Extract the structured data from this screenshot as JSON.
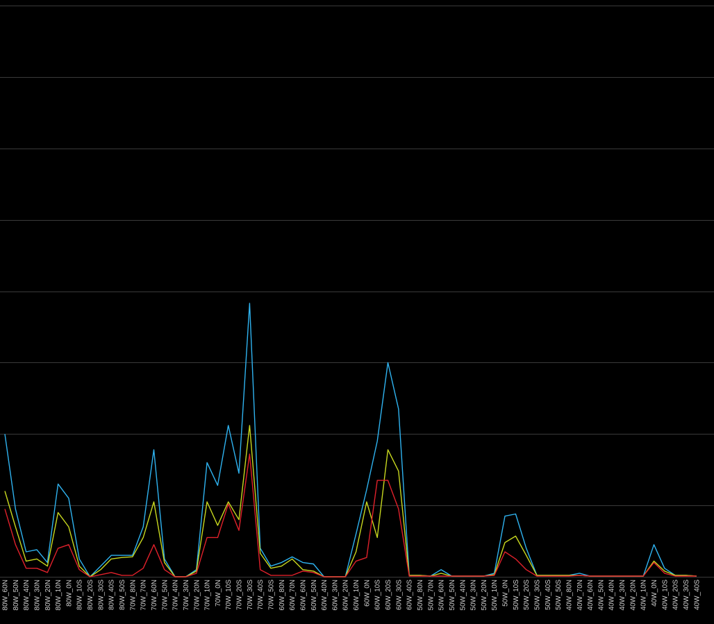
{
  "chart_data": {
    "type": "line",
    "title": "",
    "xlabel": "",
    "ylabel": "",
    "ylim": [
      0,
      8
    ],
    "grid": true,
    "legend": "none",
    "categories": [
      "80W_60N",
      "80W_50N",
      "80W_40N",
      "80W_30N",
      "80W_20N",
      "80W_10N",
      "80W_0N",
      "80W_10S",
      "80W_20S",
      "80W_30S",
      "80W_40S",
      "80W_50S",
      "70W_80N",
      "70W_70N",
      "70W_60N",
      "70W_50N",
      "70W_40N",
      "70W_30N",
      "70W_20N",
      "70W_10N",
      "70W_0N",
      "70W_10S",
      "70W_20S",
      "70W_30S",
      "70W_40S",
      "70W_50S",
      "60W_80N",
      "60W_70N",
      "60W_60N",
      "60W_50N",
      "60W_40N",
      "60W_30N",
      "60W_20N",
      "60W_10N",
      "60W_0N",
      "60W_10S",
      "60W_20S",
      "60W_30S",
      "60W_40S",
      "50W_80N",
      "50W_70N",
      "50W_60N",
      "50W_50N",
      "50W_40N",
      "50W_30N",
      "50W_20N",
      "50W_10N",
      "50W_0N",
      "50W_10S",
      "50W_20S",
      "50W_30S",
      "50W_40S",
      "50W_50S",
      "40W_80N",
      "40W_70N",
      "40W_60N",
      "40W_50N",
      "40W_40N",
      "40W_30N",
      "40W_20N",
      "40W_10N",
      "40W_0N",
      "40W_10S",
      "40W_20S",
      "40W_30S",
      "40W_40S"
    ],
    "series": [
      {
        "color": "#2fb3f0",
        "values": [
          2.0,
          0.95,
          0.35,
          0.38,
          0.2,
          1.3,
          1.1,
          0.25,
          0.0,
          0.15,
          0.3,
          0.3,
          0.3,
          0.7,
          1.78,
          0.25,
          0.0,
          0.0,
          0.1,
          1.6,
          1.28,
          2.12,
          1.45,
          3.83,
          0.4,
          0.15,
          0.2,
          0.28,
          0.2,
          0.18,
          0.0,
          0.0,
          0.0,
          0.6,
          1.22,
          1.9,
          3.0,
          2.35,
          0.02,
          0.02,
          0.01,
          0.1,
          0.01,
          0.01,
          0.01,
          0.01,
          0.05,
          0.85,
          0.88,
          0.4,
          0.02,
          0.02,
          0.02,
          0.02,
          0.05,
          0.01,
          0.01,
          0.01,
          0.01,
          0.01,
          0.01,
          0.45,
          0.12,
          0.02,
          0.02,
          0.01
        ]
      },
      {
        "color": "#c8d81f",
        "values": [
          1.2,
          0.7,
          0.22,
          0.25,
          0.15,
          0.9,
          0.7,
          0.15,
          0.0,
          0.1,
          0.25,
          0.27,
          0.28,
          0.55,
          1.05,
          0.2,
          0.0,
          0.0,
          0.08,
          1.05,
          0.72,
          1.05,
          0.8,
          2.12,
          0.33,
          0.12,
          0.15,
          0.25,
          0.1,
          0.08,
          0.0,
          0.0,
          0.0,
          0.35,
          1.05,
          0.55,
          1.78,
          1.48,
          0.02,
          0.02,
          0.01,
          0.05,
          0.01,
          0.01,
          0.01,
          0.01,
          0.03,
          0.48,
          0.57,
          0.3,
          0.02,
          0.02,
          0.02,
          0.02,
          0.02,
          0.01,
          0.01,
          0.01,
          0.01,
          0.01,
          0.01,
          0.22,
          0.08,
          0.02,
          0.02,
          0.01
        ]
      },
      {
        "color": "#e0212b",
        "values": [
          0.95,
          0.45,
          0.12,
          0.12,
          0.06,
          0.4,
          0.45,
          0.1,
          0.0,
          0.03,
          0.06,
          0.02,
          0.02,
          0.12,
          0.45,
          0.1,
          0.0,
          0.0,
          0.05,
          0.55,
          0.55,
          1.02,
          0.65,
          1.72,
          0.1,
          0.02,
          0.02,
          0.02,
          0.08,
          0.06,
          0.0,
          0.0,
          0.0,
          0.22,
          0.27,
          1.35,
          1.35,
          0.95,
          0.01,
          0.01,
          0.01,
          0.01,
          0.01,
          0.01,
          0.01,
          0.01,
          0.02,
          0.35,
          0.25,
          0.1,
          0.01,
          0.01,
          0.01,
          0.01,
          0.02,
          0.01,
          0.01,
          0.01,
          0.01,
          0.01,
          0.01,
          0.2,
          0.05,
          0.01,
          0.01,
          0.01
        ]
      }
    ]
  }
}
